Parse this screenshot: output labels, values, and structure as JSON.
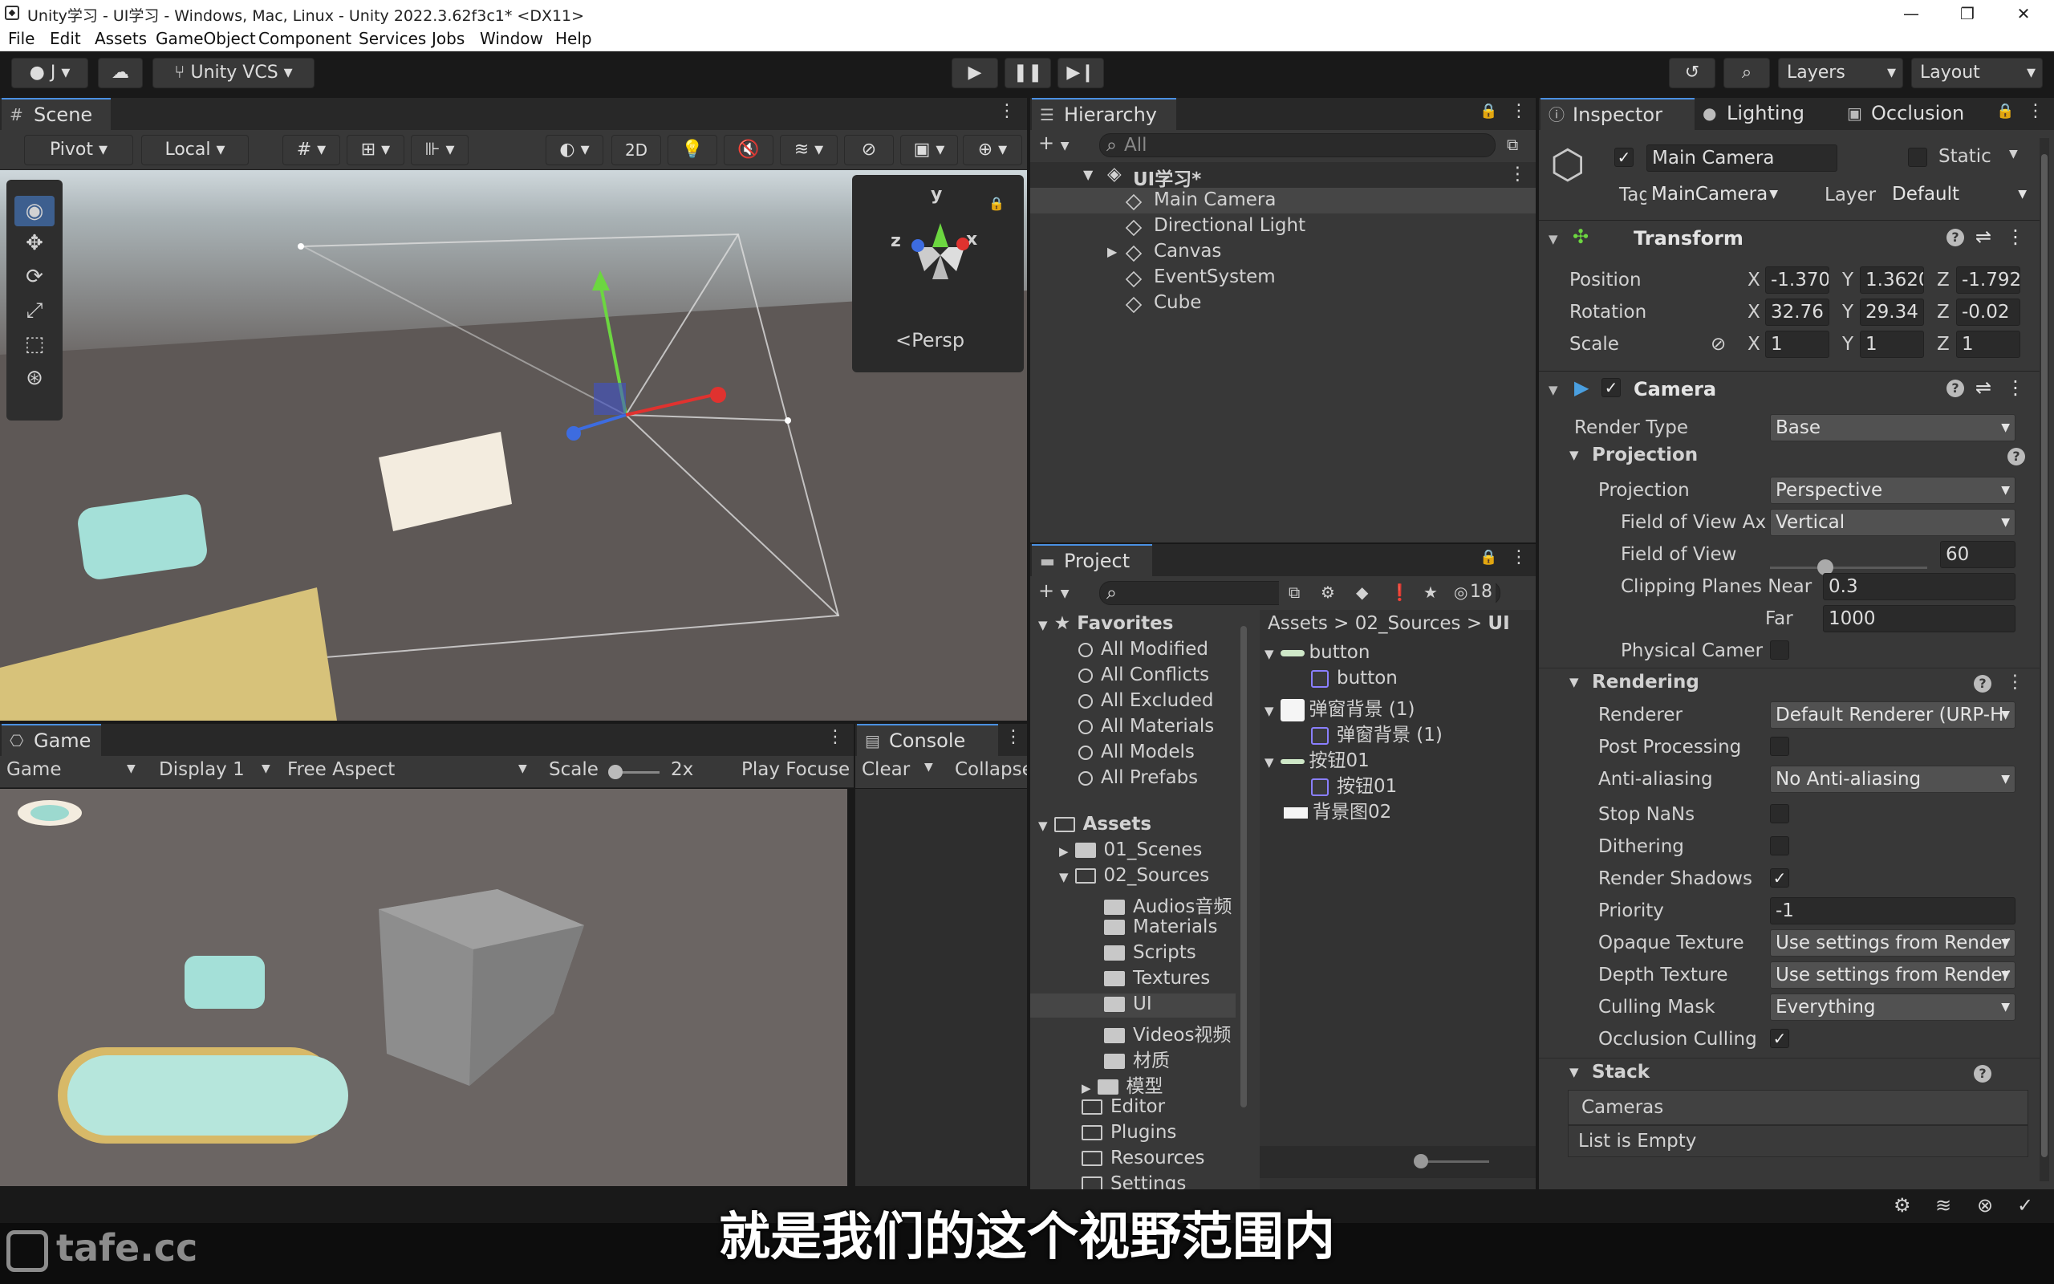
{
  "window": {
    "title": "Unity学习 - UI学习 - Windows, Mac, Linux - Unity 2022.3.62f3c1* <DX11>",
    "minimize": "—",
    "maximize": "❐",
    "close": "✕"
  },
  "menu": [
    "File",
    "Edit",
    "Assets",
    "GameObject",
    "Component",
    "Services",
    "Jobs",
    "Window",
    "Help"
  ],
  "toolbar": {
    "account": "J",
    "vcs": "Unity VCS",
    "layers": "Layers",
    "layout": "Layout"
  },
  "scene": {
    "tab": "Scene",
    "pivot": "Pivot",
    "local": "Local",
    "mode2d": "2D",
    "gizmo_axes": [
      "y",
      "z",
      "x"
    ],
    "persp": "Persp"
  },
  "game": {
    "tab": "Game",
    "mode": "Game",
    "display": "Display 1",
    "aspect": "Free Aspect",
    "scale_label": "Scale",
    "scale_value": "2x",
    "play_focused": "Play Focuse"
  },
  "console": {
    "tab": "Console",
    "clear": "Clear",
    "collapse": "Collapse"
  },
  "hierarchy": {
    "tab": "Hierarchy",
    "search_placeholder": "All",
    "scene": "UI学习*",
    "items": [
      "Main Camera",
      "Directional Light",
      "Canvas",
      "EventSystem",
      "Cube"
    ]
  },
  "project": {
    "tab": "Project",
    "count": "18",
    "favorites_label": "Favorites",
    "favorites": [
      "All Modified",
      "All Conflicts",
      "All Excluded",
      "All Materials",
      "All Models",
      "All Prefabs"
    ],
    "assets_label": "Assets",
    "tree": [
      {
        "l": "01_Scenes",
        "d": 1
      },
      {
        "l": "02_Sources",
        "d": 1
      },
      {
        "l": "Audios音频",
        "d": 2
      },
      {
        "l": "Materials",
        "d": 2
      },
      {
        "l": "Scripts",
        "d": 2
      },
      {
        "l": "Textures",
        "d": 2
      },
      {
        "l": "UI",
        "d": 2
      },
      {
        "l": "Videos视频",
        "d": 2
      },
      {
        "l": "材质",
        "d": 2
      },
      {
        "l": "模型",
        "d": 2
      },
      {
        "l": "Editor",
        "d": 1
      },
      {
        "l": "Plugins",
        "d": 1
      },
      {
        "l": "Resources",
        "d": 1
      },
      {
        "l": "Settings",
        "d": 1
      }
    ],
    "breadcrumb": [
      "Assets",
      "02_Sources",
      "UI"
    ],
    "files": [
      {
        "l": "button",
        "sub": false
      },
      {
        "l": "button",
        "sub": true
      },
      {
        "l": "弹窗背景 (1)",
        "sub": false
      },
      {
        "l": "弹窗背景 (1)",
        "sub": true
      },
      {
        "l": "按钮01",
        "sub": false
      },
      {
        "l": "按钮01",
        "sub": true
      },
      {
        "l": "背景图02",
        "sub": false
      }
    ]
  },
  "inspector": {
    "tabs": [
      "Inspector",
      "Lighting",
      "Occlusion"
    ],
    "name": "Main Camera",
    "static": "Static",
    "tag_label": "Tag",
    "tag": "MainCamera",
    "layer_label": "Layer",
    "layer": "Default",
    "transform": {
      "title": "Transform",
      "position_label": "Position",
      "rotation_label": "Rotation",
      "scale_label": "Scale",
      "x": "X",
      "y": "Y",
      "z": "Z",
      "position": [
        "-1.370",
        "1.3620",
        "-1.792"
      ],
      "rotation": [
        "32.76",
        "29.34",
        "-0.02"
      ],
      "scale": [
        "1",
        "1",
        "1"
      ]
    },
    "camera": {
      "title": "Camera",
      "render_type_label": "Render Type",
      "render_type": "Base",
      "projection_section": "Projection",
      "projection_label": "Projection",
      "projection": "Perspective",
      "fov_axis_label": "Field of View Ax",
      "fov_axis": "Vertical",
      "fov_label": "Field of View",
      "fov": "60",
      "fov_slider_fraction": 0.35,
      "clip_near_label": "Clipping Planes Near",
      "clip_near": "0.3",
      "clip_far_label": "Far",
      "clip_far": "1000",
      "physical_label": "Physical Camer",
      "rendering_section": "Rendering",
      "renderer_label": "Renderer",
      "renderer": "Default Renderer (URP-H",
      "post_label": "Post Processing",
      "aa_label": "Anti-aliasing",
      "aa": "No Anti-aliasing",
      "stopnan_label": "Stop NaNs",
      "dither_label": "Dithering",
      "shadows_label": "Render Shadows",
      "priority_label": "Priority",
      "priority": "-1",
      "opaque_label": "Opaque Texture",
      "opaque": "Use settings from Render",
      "depth_label": "Depth Texture",
      "depth": "Use settings from Render",
      "culling_label": "Culling Mask",
      "culling": "Everything",
      "occl_label": "Occlusion Culling",
      "stack_section": "Stack",
      "cameras_label": "Cameras",
      "list_empty": "List is Empty"
    }
  },
  "subtitle": "就是我们的这个视野范围内",
  "watermark": "tafe.cc"
}
